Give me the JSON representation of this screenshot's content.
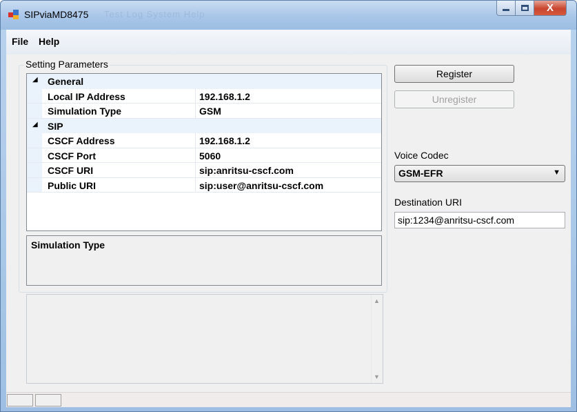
{
  "window": {
    "title": "SIPviaMD8475",
    "title_ghost": "Test  Log  System  Help",
    "close_glyph": "X"
  },
  "menu": [
    "File",
    "Help"
  ],
  "settings": {
    "group_label": "Setting Parameters",
    "categories": [
      {
        "name": "General",
        "properties": [
          {
            "name": "Local IP Address",
            "value": "192.168.1.2"
          },
          {
            "name": "Simulation Type",
            "value": "GSM"
          }
        ]
      },
      {
        "name": "SIP",
        "properties": [
          {
            "name": "CSCF Address",
            "value": "192.168.1.2"
          },
          {
            "name": "CSCF Port",
            "value": "5060"
          },
          {
            "name": "CSCF URI",
            "value": "sip:anritsu-cscf.com"
          },
          {
            "name": "Public URI",
            "value": "sip:user@anritsu-cscf.com"
          }
        ]
      }
    ],
    "description_title": "Simulation Type"
  },
  "actions": {
    "register_label": "Register",
    "unregister_label": "Unregister"
  },
  "voice_codec": {
    "label": "Voice Codec",
    "selected": "GSM-EFR"
  },
  "destination": {
    "label": "Destination URI",
    "value": "sip:1234@anritsu-cscf.com"
  },
  "icons": {
    "app": "app-icon",
    "expand": "triangle-expanded-icon",
    "dropdown": "chevron-down-icon"
  }
}
